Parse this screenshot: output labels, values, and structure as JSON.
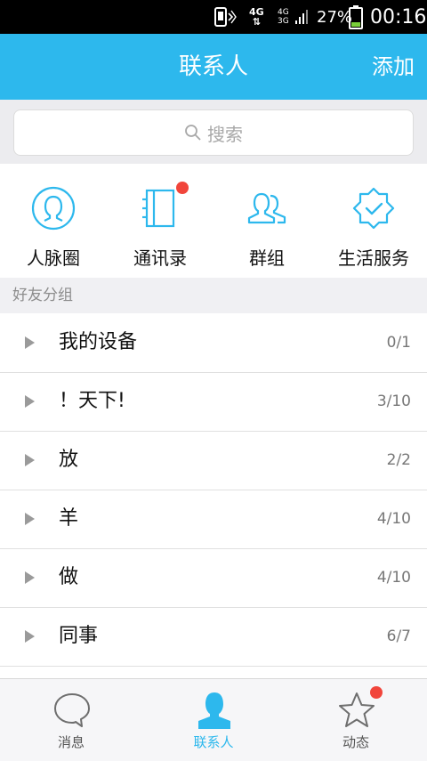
{
  "status_bar": {
    "network": "4G",
    "signal_labels": [
      "4G",
      "3G"
    ],
    "battery_percent": "27%",
    "time": "00:16"
  },
  "header": {
    "title": "联系人",
    "add_label": "添加"
  },
  "search": {
    "placeholder": "搜索"
  },
  "quick_entries": [
    {
      "label": "人脉圈",
      "icon": "person-circle-icon",
      "badge": false
    },
    {
      "label": "通讯录",
      "icon": "address-book-icon",
      "badge": true
    },
    {
      "label": "群组",
      "icon": "group-icon",
      "badge": false
    },
    {
      "label": "生活服务",
      "icon": "badge-check-icon",
      "badge": false
    }
  ],
  "section": {
    "title": "好友分组"
  },
  "groups": [
    {
      "name": "我的设备",
      "count": "0/1"
    },
    {
      "name": "！天下!",
      "count": "3/10"
    },
    {
      "name": "放",
      "count": "2/2"
    },
    {
      "name": "羊",
      "count": "4/10"
    },
    {
      "name": "做",
      "count": "4/10"
    },
    {
      "name": "同事",
      "count": "6/7"
    }
  ],
  "tabs": [
    {
      "label": "消息",
      "icon": "chat-bubble-icon",
      "active": false,
      "badge": false
    },
    {
      "label": "联系人",
      "icon": "contact-person-icon",
      "active": true,
      "badge": false
    },
    {
      "label": "动态",
      "icon": "star-icon",
      "active": false,
      "badge": true
    }
  ],
  "colors": {
    "accent": "#2db8ed",
    "badge": "#f1453b",
    "status_bar": "#000000"
  }
}
